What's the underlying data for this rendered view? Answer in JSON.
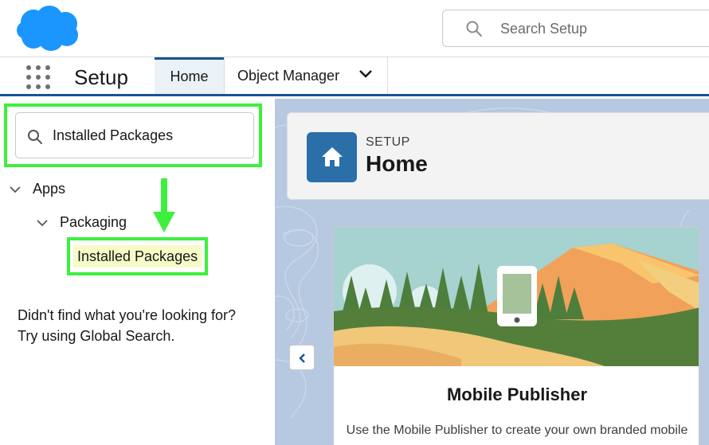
{
  "header": {
    "search_placeholder": "Search Setup",
    "brand_color": "#1b96ff"
  },
  "nav": {
    "app_name": "Setup",
    "tabs": [
      {
        "label": "Home",
        "active": true
      },
      {
        "label": "Object Manager",
        "active": false
      }
    ]
  },
  "sidebar": {
    "quick_find_value": "Installed Packages",
    "tree": {
      "root": "Apps",
      "child": "Packaging",
      "leaf": "Installed Packages"
    },
    "not_found_line1": "Didn't find what you're looking for?",
    "not_found_line2": "Try using Global Search.",
    "highlight_color": "#3ef03e"
  },
  "main": {
    "breadcrumb": "SETUP",
    "title": "Home",
    "card": {
      "title": "Mobile Publisher",
      "description": "Use the Mobile Publisher to create your own branded mobile app."
    }
  }
}
